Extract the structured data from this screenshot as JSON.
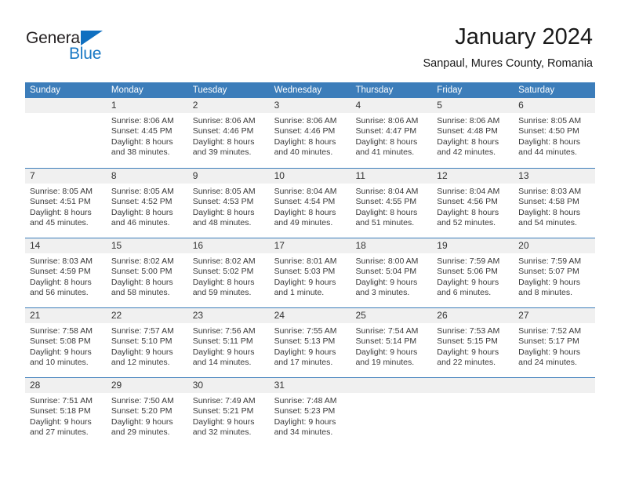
{
  "brand": {
    "name_part1": "General",
    "name_part2": "Blue",
    "triangle_color": "#0f6fc0",
    "blue_color": "#1878c4"
  },
  "header": {
    "title": "January 2024",
    "subtitle": "Sanpaul, Mures County, Romania"
  },
  "theme": {
    "header_bar_color": "#3c7dba",
    "day_band_color": "#f0f0f0",
    "week_separator_color": "#3c7dba"
  },
  "weekdays": [
    "Sunday",
    "Monday",
    "Tuesday",
    "Wednesday",
    "Thursday",
    "Friday",
    "Saturday"
  ],
  "weeks": [
    [
      {
        "day": "",
        "sunrise": "",
        "sunset": "",
        "daylight_line1": "",
        "daylight_line2": ""
      },
      {
        "day": "1",
        "sunrise": "Sunrise: 8:06 AM",
        "sunset": "Sunset: 4:45 PM",
        "daylight_line1": "Daylight: 8 hours",
        "daylight_line2": "and 38 minutes."
      },
      {
        "day": "2",
        "sunrise": "Sunrise: 8:06 AM",
        "sunset": "Sunset: 4:46 PM",
        "daylight_line1": "Daylight: 8 hours",
        "daylight_line2": "and 39 minutes."
      },
      {
        "day": "3",
        "sunrise": "Sunrise: 8:06 AM",
        "sunset": "Sunset: 4:46 PM",
        "daylight_line1": "Daylight: 8 hours",
        "daylight_line2": "and 40 minutes."
      },
      {
        "day": "4",
        "sunrise": "Sunrise: 8:06 AM",
        "sunset": "Sunset: 4:47 PM",
        "daylight_line1": "Daylight: 8 hours",
        "daylight_line2": "and 41 minutes."
      },
      {
        "day": "5",
        "sunrise": "Sunrise: 8:06 AM",
        "sunset": "Sunset: 4:48 PM",
        "daylight_line1": "Daylight: 8 hours",
        "daylight_line2": "and 42 minutes."
      },
      {
        "day": "6",
        "sunrise": "Sunrise: 8:05 AM",
        "sunset": "Sunset: 4:50 PM",
        "daylight_line1": "Daylight: 8 hours",
        "daylight_line2": "and 44 minutes."
      }
    ],
    [
      {
        "day": "7",
        "sunrise": "Sunrise: 8:05 AM",
        "sunset": "Sunset: 4:51 PM",
        "daylight_line1": "Daylight: 8 hours",
        "daylight_line2": "and 45 minutes."
      },
      {
        "day": "8",
        "sunrise": "Sunrise: 8:05 AM",
        "sunset": "Sunset: 4:52 PM",
        "daylight_line1": "Daylight: 8 hours",
        "daylight_line2": "and 46 minutes."
      },
      {
        "day": "9",
        "sunrise": "Sunrise: 8:05 AM",
        "sunset": "Sunset: 4:53 PM",
        "daylight_line1": "Daylight: 8 hours",
        "daylight_line2": "and 48 minutes."
      },
      {
        "day": "10",
        "sunrise": "Sunrise: 8:04 AM",
        "sunset": "Sunset: 4:54 PM",
        "daylight_line1": "Daylight: 8 hours",
        "daylight_line2": "and 49 minutes."
      },
      {
        "day": "11",
        "sunrise": "Sunrise: 8:04 AM",
        "sunset": "Sunset: 4:55 PM",
        "daylight_line1": "Daylight: 8 hours",
        "daylight_line2": "and 51 minutes."
      },
      {
        "day": "12",
        "sunrise": "Sunrise: 8:04 AM",
        "sunset": "Sunset: 4:56 PM",
        "daylight_line1": "Daylight: 8 hours",
        "daylight_line2": "and 52 minutes."
      },
      {
        "day": "13",
        "sunrise": "Sunrise: 8:03 AM",
        "sunset": "Sunset: 4:58 PM",
        "daylight_line1": "Daylight: 8 hours",
        "daylight_line2": "and 54 minutes."
      }
    ],
    [
      {
        "day": "14",
        "sunrise": "Sunrise: 8:03 AM",
        "sunset": "Sunset: 4:59 PM",
        "daylight_line1": "Daylight: 8 hours",
        "daylight_line2": "and 56 minutes."
      },
      {
        "day": "15",
        "sunrise": "Sunrise: 8:02 AM",
        "sunset": "Sunset: 5:00 PM",
        "daylight_line1": "Daylight: 8 hours",
        "daylight_line2": "and 58 minutes."
      },
      {
        "day": "16",
        "sunrise": "Sunrise: 8:02 AM",
        "sunset": "Sunset: 5:02 PM",
        "daylight_line1": "Daylight: 8 hours",
        "daylight_line2": "and 59 minutes."
      },
      {
        "day": "17",
        "sunrise": "Sunrise: 8:01 AM",
        "sunset": "Sunset: 5:03 PM",
        "daylight_line1": "Daylight: 9 hours",
        "daylight_line2": "and 1 minute."
      },
      {
        "day": "18",
        "sunrise": "Sunrise: 8:00 AM",
        "sunset": "Sunset: 5:04 PM",
        "daylight_line1": "Daylight: 9 hours",
        "daylight_line2": "and 3 minutes."
      },
      {
        "day": "19",
        "sunrise": "Sunrise: 7:59 AM",
        "sunset": "Sunset: 5:06 PM",
        "daylight_line1": "Daylight: 9 hours",
        "daylight_line2": "and 6 minutes."
      },
      {
        "day": "20",
        "sunrise": "Sunrise: 7:59 AM",
        "sunset": "Sunset: 5:07 PM",
        "daylight_line1": "Daylight: 9 hours",
        "daylight_line2": "and 8 minutes."
      }
    ],
    [
      {
        "day": "21",
        "sunrise": "Sunrise: 7:58 AM",
        "sunset": "Sunset: 5:08 PM",
        "daylight_line1": "Daylight: 9 hours",
        "daylight_line2": "and 10 minutes."
      },
      {
        "day": "22",
        "sunrise": "Sunrise: 7:57 AM",
        "sunset": "Sunset: 5:10 PM",
        "daylight_line1": "Daylight: 9 hours",
        "daylight_line2": "and 12 minutes."
      },
      {
        "day": "23",
        "sunrise": "Sunrise: 7:56 AM",
        "sunset": "Sunset: 5:11 PM",
        "daylight_line1": "Daylight: 9 hours",
        "daylight_line2": "and 14 minutes."
      },
      {
        "day": "24",
        "sunrise": "Sunrise: 7:55 AM",
        "sunset": "Sunset: 5:13 PM",
        "daylight_line1": "Daylight: 9 hours",
        "daylight_line2": "and 17 minutes."
      },
      {
        "day": "25",
        "sunrise": "Sunrise: 7:54 AM",
        "sunset": "Sunset: 5:14 PM",
        "daylight_line1": "Daylight: 9 hours",
        "daylight_line2": "and 19 minutes."
      },
      {
        "day": "26",
        "sunrise": "Sunrise: 7:53 AM",
        "sunset": "Sunset: 5:15 PM",
        "daylight_line1": "Daylight: 9 hours",
        "daylight_line2": "and 22 minutes."
      },
      {
        "day": "27",
        "sunrise": "Sunrise: 7:52 AM",
        "sunset": "Sunset: 5:17 PM",
        "daylight_line1": "Daylight: 9 hours",
        "daylight_line2": "and 24 minutes."
      }
    ],
    [
      {
        "day": "28",
        "sunrise": "Sunrise: 7:51 AM",
        "sunset": "Sunset: 5:18 PM",
        "daylight_line1": "Daylight: 9 hours",
        "daylight_line2": "and 27 minutes."
      },
      {
        "day": "29",
        "sunrise": "Sunrise: 7:50 AM",
        "sunset": "Sunset: 5:20 PM",
        "daylight_line1": "Daylight: 9 hours",
        "daylight_line2": "and 29 minutes."
      },
      {
        "day": "30",
        "sunrise": "Sunrise: 7:49 AM",
        "sunset": "Sunset: 5:21 PM",
        "daylight_line1": "Daylight: 9 hours",
        "daylight_line2": "and 32 minutes."
      },
      {
        "day": "31",
        "sunrise": "Sunrise: 7:48 AM",
        "sunset": "Sunset: 5:23 PM",
        "daylight_line1": "Daylight: 9 hours",
        "daylight_line2": "and 34 minutes."
      },
      {
        "day": "",
        "sunrise": "",
        "sunset": "",
        "daylight_line1": "",
        "daylight_line2": ""
      },
      {
        "day": "",
        "sunrise": "",
        "sunset": "",
        "daylight_line1": "",
        "daylight_line2": ""
      },
      {
        "day": "",
        "sunrise": "",
        "sunset": "",
        "daylight_line1": "",
        "daylight_line2": ""
      }
    ]
  ]
}
